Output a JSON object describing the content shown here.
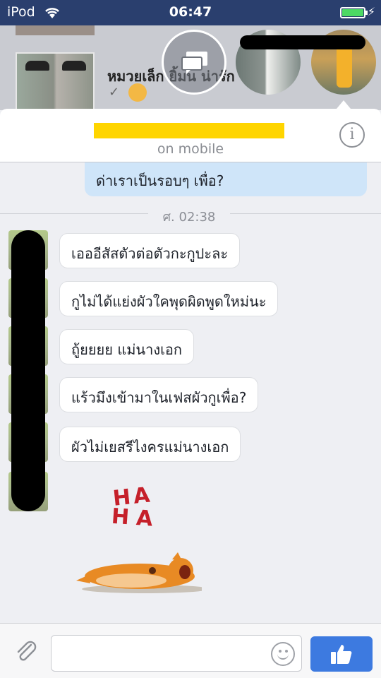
{
  "status_bar": {
    "carrier": "iPod",
    "time": "06:47",
    "wifi_icon": "wifi-icon",
    "battery_icon": "battery-icon",
    "battery_level": 1.0,
    "charging_icon": "bolt-icon"
  },
  "background_list": {
    "conversation_name": "หมวยเล็ก ยิ้มน น่ารัก",
    "status_check": "✓"
  },
  "chat_heads": [
    "messages-chathead-icon",
    "contact-chathead-2",
    "contact-chathead-3"
  ],
  "header": {
    "subtitle": "on mobile",
    "info_label": "i"
  },
  "messages": {
    "outgoing_partial": "ด่าเราเป็นรอบๆ เพื่อ?",
    "timestamp": "ศ. 02:38",
    "incoming": [
      "เอออีสัสตัวต่อตัวกะกูปะละ",
      "กูไม่ได้แย่งผัวใคพุดผิดพูดใหม่นะ",
      "ถู้ยยยย แม่นางเอก",
      "แร้วมึงเข้ามาในเฟสผัวกูเพื่อ?",
      "ผัวไม่เยสรีไงครแม่นางเอก"
    ],
    "sticker": {
      "line1": "HA",
      "line2": "HA"
    }
  },
  "composer": {
    "placeholder": "",
    "attach_icon": "paperclip-icon",
    "emoji_icon": "smiley-icon",
    "like_icon": "thumbs-up-icon"
  },
  "colors": {
    "status_bar": "#2a3f6e",
    "outgoing_bubble": "#cfe5f9",
    "like_button": "#3d7ae0",
    "battery": "#4cd964",
    "sticker_text": "#c5202a"
  }
}
